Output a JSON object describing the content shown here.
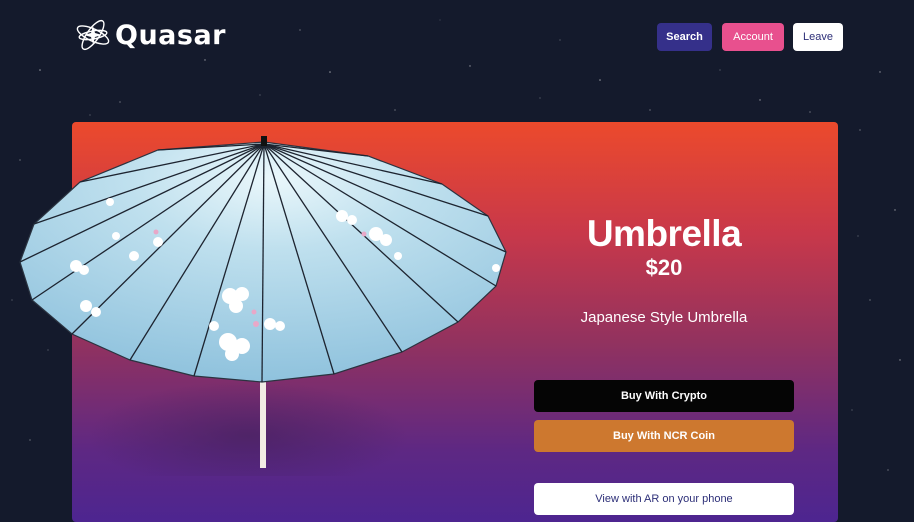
{
  "brand": {
    "name": "Quasar",
    "logo_icon": "atom-icon"
  },
  "nav": {
    "search_label": "Search",
    "account_label": "Account",
    "leave_label": "Leave"
  },
  "product": {
    "title": "Umbrella",
    "price": "$20",
    "description": "Japanese Style Umbrella",
    "image_icon": "umbrella-icon"
  },
  "actions": {
    "buy_crypto_label": "Buy With Crypto",
    "buy_ncr_label": "Buy With NCR Coin",
    "ar_label": "View with AR on your phone"
  },
  "colors": {
    "background": "#141a2c",
    "search_button": "#35308a",
    "account_button": "#e8508e",
    "ncr_button": "#cd782f",
    "gradient_top": "#ec4a2c",
    "gradient_bottom": "#4d2590"
  }
}
